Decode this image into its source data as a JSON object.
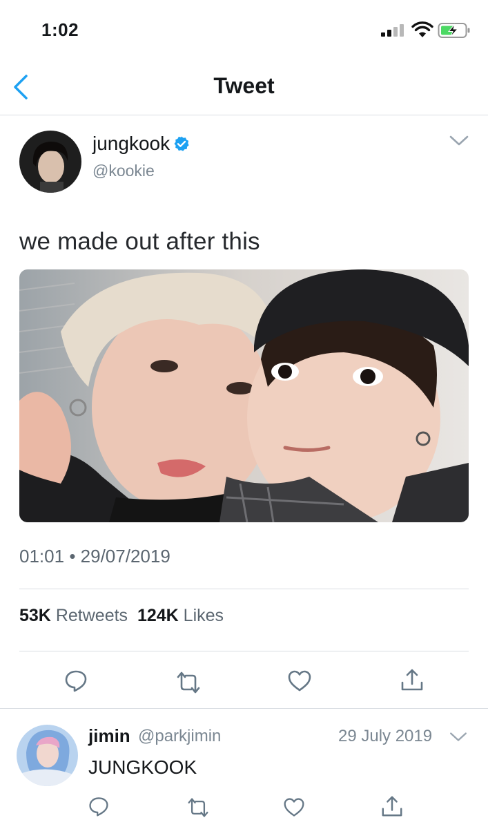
{
  "status_bar": {
    "time": "1:02"
  },
  "nav": {
    "title": "Tweet"
  },
  "tweet": {
    "author_name": "jungkook",
    "author_handle": "@kookie",
    "text": "we made out after this",
    "time": "01:01",
    "separator": "•",
    "date": "29/07/2019",
    "retweets_count": "53K",
    "retweets_label": "Retweets",
    "likes_count": "124K",
    "likes_label": "Likes"
  },
  "reply": {
    "author_name": "jimin",
    "author_handle": "@parkjimin",
    "date": "29 July 2019",
    "text": "JUNGKOOK"
  },
  "colors": {
    "accent": "#1da1f2",
    "icon_gray": "#657786",
    "battery_green": "#4cd964"
  },
  "icons": [
    "back-chevron-icon",
    "verified-badge-icon",
    "chevron-down-icon",
    "reply-icon",
    "retweet-icon",
    "like-icon",
    "share-icon"
  ]
}
